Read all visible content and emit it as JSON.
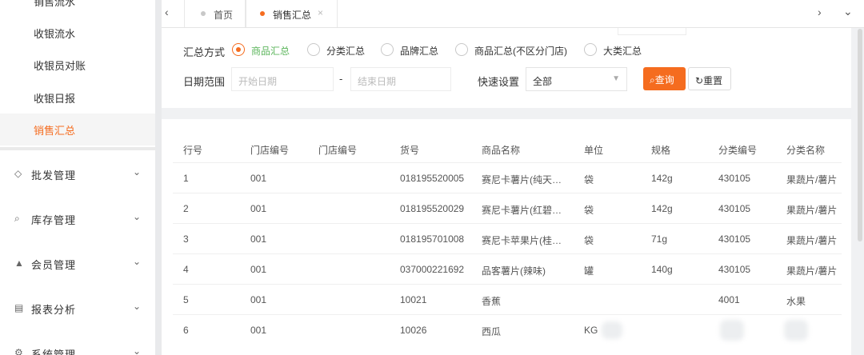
{
  "sidebar": {
    "sub_items": [
      "销售流水",
      "收银流水",
      "收银员对账",
      "收银日报",
      "销售汇总"
    ],
    "menus": [
      {
        "icon": "◇",
        "icon_name": "diamond-icon",
        "label": "批发管理"
      },
      {
        "icon": "⌕",
        "icon_name": "search-icon",
        "label": "库存管理"
      },
      {
        "icon": "▲",
        "icon_name": "user-icon",
        "label": "会员管理"
      },
      {
        "icon": "▤",
        "icon_name": "grid-icon",
        "label": "报表分析"
      },
      {
        "icon": "⚙",
        "icon_name": "gear-icon",
        "label": "系统管理"
      }
    ],
    "chevron": "⌄"
  },
  "tabs": {
    "nav_left": "‹",
    "nav_right": "›",
    "collapse": "⌄",
    "items": [
      {
        "label": "首页",
        "dot_color": "#c8c8c8"
      },
      {
        "label": "销售汇总",
        "dot_color": "#f56c1f",
        "close": "×"
      }
    ]
  },
  "filter": {
    "summary_label": "汇总方式",
    "options": [
      "商品汇总",
      "分类汇总",
      "品牌汇总",
      "商品汇总(不区分门店)",
      "大类汇总"
    ],
    "selected_index": 0,
    "date_label": "日期范围",
    "start_placeholder": "开始日期",
    "date_sep": "-",
    "end_placeholder": "结束日期",
    "quick_label": "快速设置",
    "quick_value": "全部",
    "query_icon": "⌕",
    "query_label": "查询",
    "reset_icon": "↻",
    "reset_label": "重置"
  },
  "table": {
    "headers": [
      "行号",
      "门店编号",
      "门店编号",
      "货号",
      "商品名称",
      "单位",
      "规格",
      "分类编号",
      "分类名称"
    ],
    "rows": [
      [
        "1",
        "001",
        "",
        "018195520005",
        "赛尼卡薯片(纯天…",
        "袋",
        "142g",
        "430105",
        "果蔬片/薯片"
      ],
      [
        "2",
        "001",
        "",
        "018195520029",
        "赛尼卡薯片(红碧…",
        "袋",
        "142g",
        "430105",
        "果蔬片/薯片"
      ],
      [
        "3",
        "001",
        "",
        "018195701008",
        "赛尼卡苹果片(桂…",
        "袋",
        "71g",
        "430105",
        "果蔬片/薯片"
      ],
      [
        "4",
        "001",
        "",
        "037000221692",
        "品客薯片(辣味)",
        "罐",
        "140g",
        "430105",
        "果蔬片/薯片"
      ],
      [
        "5",
        "001",
        "",
        "10021",
        "香蕉",
        "",
        "",
        "4001",
        "水果"
      ],
      [
        "6",
        "001",
        "",
        "10026",
        "西瓜",
        "KG",
        "",
        "",
        ""
      ]
    ]
  },
  "colors": {
    "accent": "#f56c1f",
    "selected_text": "#5bb55b"
  }
}
